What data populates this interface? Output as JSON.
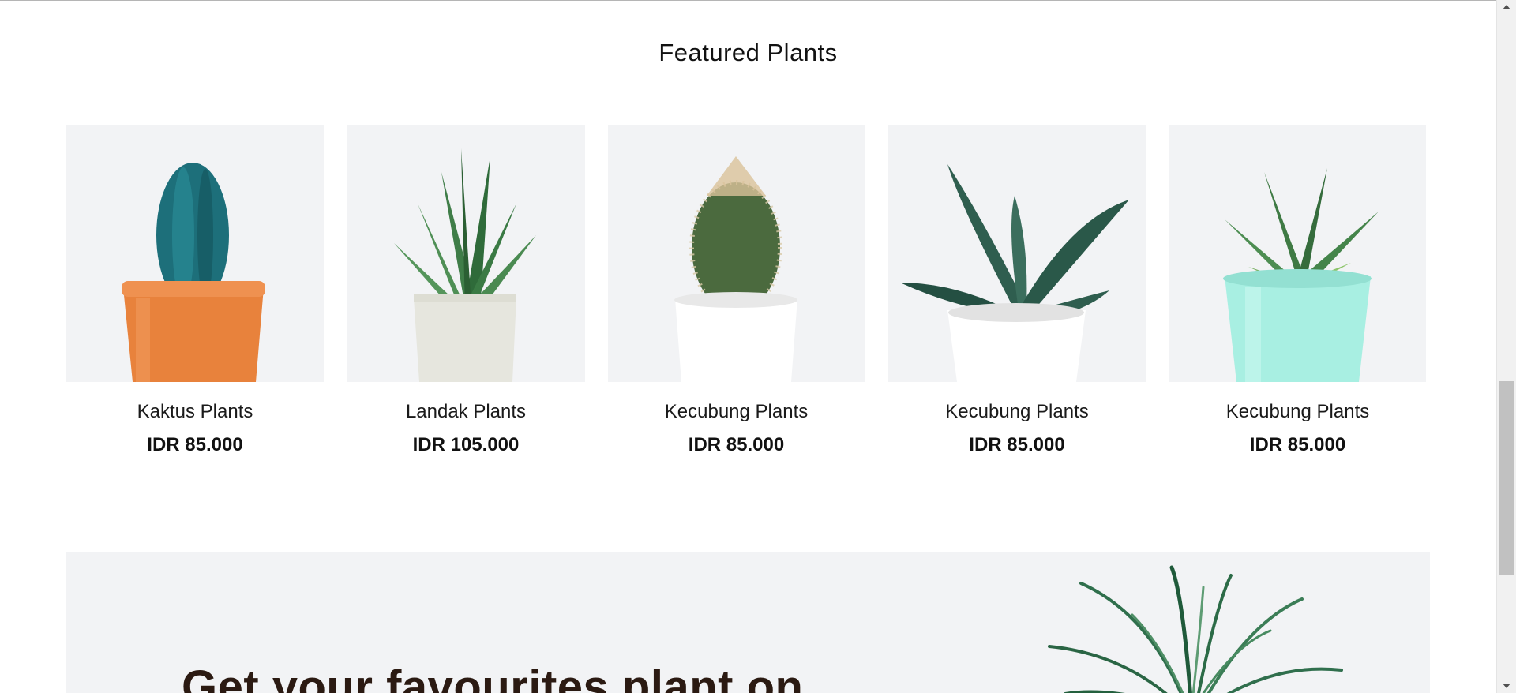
{
  "section": {
    "title": "Featured Plants"
  },
  "products": [
    {
      "name": "Kaktus Plants",
      "price": "IDR 85.000",
      "image": "cactus-orange-pot"
    },
    {
      "name": "Landak Plants",
      "price": "IDR 105.000",
      "image": "aloe-concrete-pot"
    },
    {
      "name": "Kecubung Plants",
      "price": "IDR 85.000",
      "image": "cactus-white-pot"
    },
    {
      "name": "Kecubung Plants",
      "price": "IDR 85.000",
      "image": "gasteria-white-pot"
    },
    {
      "name": "Kecubung Plants",
      "price": "IDR 85.000",
      "image": "haworthia-mint-pot"
    }
  ],
  "promo": {
    "heading": "Get your favourites plant on",
    "image": "spider-plant"
  },
  "colors": {
    "card_bg": "#f2f3f5",
    "heading_brown": "#2b1a12",
    "orange_pot": "#e8823c",
    "mint_pot": "#a8efe2"
  },
  "icons": {
    "scroll_up": "triangle-up-icon",
    "scroll_down": "triangle-down-icon"
  }
}
